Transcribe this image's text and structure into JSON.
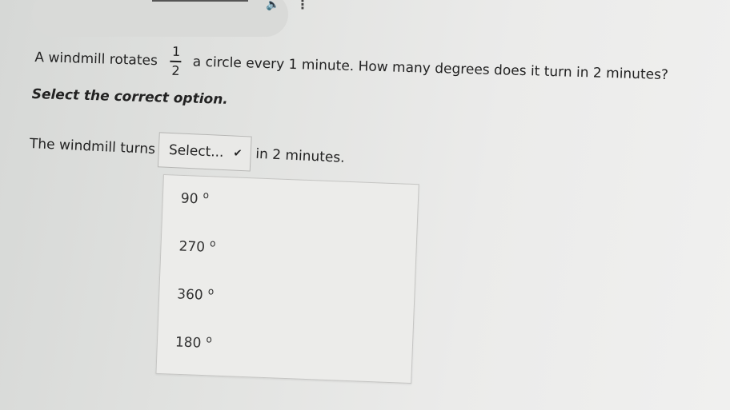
{
  "question": {
    "prefix": "A windmill rotates",
    "fraction_numerator": "1",
    "fraction_denominator": "2",
    "suffix": "a circle every 1 minute. How many degrees does it turn in 2 minutes?"
  },
  "instruction": "Select the correct option.",
  "answer": {
    "prefix": "The windmill turns",
    "dropdown_placeholder": "Select...",
    "suffix": "in 2 minutes."
  },
  "options": [
    {
      "value": "90",
      "unit": "o"
    },
    {
      "value": "270",
      "unit": "o"
    },
    {
      "value": "360",
      "unit": "o"
    },
    {
      "value": "180",
      "unit": "o"
    }
  ],
  "icons": {
    "speaker": "speaker-icon",
    "menu": "kebab-menu-icon",
    "dropdown": "chevron-down-icon"
  }
}
